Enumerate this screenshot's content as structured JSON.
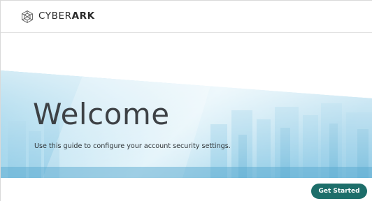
{
  "header": {
    "brand_light": "CYBER",
    "brand_bold": "ARK",
    "logo_icon": "cyberark-hexagon-logo-icon"
  },
  "hero": {
    "title": "Welcome",
    "subtitle": "Use this guide to configure your account security settings."
  },
  "actions": {
    "get_started_label": "Get Started"
  },
  "colors": {
    "primary_button": "#1d6e6a",
    "hero_blue": "#4fb0d6",
    "hero_light": "#d6eef7"
  }
}
